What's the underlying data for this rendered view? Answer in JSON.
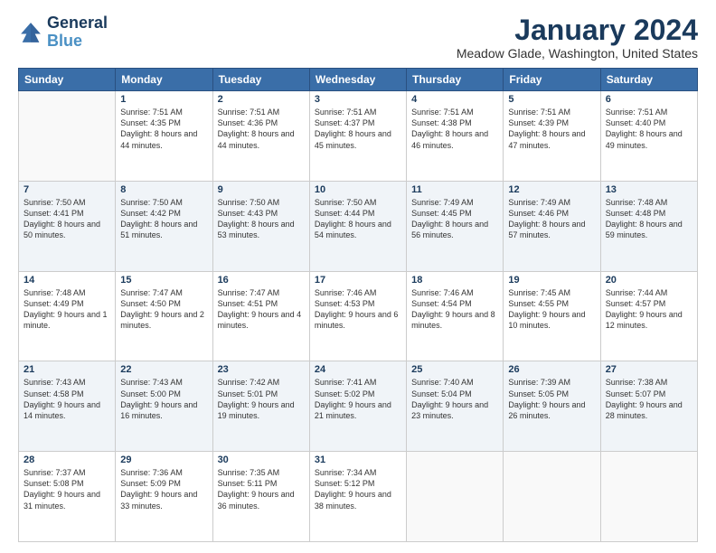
{
  "logo": {
    "text_general": "General",
    "text_blue": "Blue"
  },
  "title": "January 2024",
  "location": "Meadow Glade, Washington, United States",
  "days_of_week": [
    "Sunday",
    "Monday",
    "Tuesday",
    "Wednesday",
    "Thursday",
    "Friday",
    "Saturday"
  ],
  "weeks": [
    [
      {
        "day": "",
        "sunrise": "",
        "sunset": "",
        "daylight": ""
      },
      {
        "day": "1",
        "sunrise": "Sunrise: 7:51 AM",
        "sunset": "Sunset: 4:35 PM",
        "daylight": "Daylight: 8 hours and 44 minutes."
      },
      {
        "day": "2",
        "sunrise": "Sunrise: 7:51 AM",
        "sunset": "Sunset: 4:36 PM",
        "daylight": "Daylight: 8 hours and 44 minutes."
      },
      {
        "day": "3",
        "sunrise": "Sunrise: 7:51 AM",
        "sunset": "Sunset: 4:37 PM",
        "daylight": "Daylight: 8 hours and 45 minutes."
      },
      {
        "day": "4",
        "sunrise": "Sunrise: 7:51 AM",
        "sunset": "Sunset: 4:38 PM",
        "daylight": "Daylight: 8 hours and 46 minutes."
      },
      {
        "day": "5",
        "sunrise": "Sunrise: 7:51 AM",
        "sunset": "Sunset: 4:39 PM",
        "daylight": "Daylight: 8 hours and 47 minutes."
      },
      {
        "day": "6",
        "sunrise": "Sunrise: 7:51 AM",
        "sunset": "Sunset: 4:40 PM",
        "daylight": "Daylight: 8 hours and 49 minutes."
      }
    ],
    [
      {
        "day": "7",
        "sunrise": "Sunrise: 7:50 AM",
        "sunset": "Sunset: 4:41 PM",
        "daylight": "Daylight: 8 hours and 50 minutes."
      },
      {
        "day": "8",
        "sunrise": "Sunrise: 7:50 AM",
        "sunset": "Sunset: 4:42 PM",
        "daylight": "Daylight: 8 hours and 51 minutes."
      },
      {
        "day": "9",
        "sunrise": "Sunrise: 7:50 AM",
        "sunset": "Sunset: 4:43 PM",
        "daylight": "Daylight: 8 hours and 53 minutes."
      },
      {
        "day": "10",
        "sunrise": "Sunrise: 7:50 AM",
        "sunset": "Sunset: 4:44 PM",
        "daylight": "Daylight: 8 hours and 54 minutes."
      },
      {
        "day": "11",
        "sunrise": "Sunrise: 7:49 AM",
        "sunset": "Sunset: 4:45 PM",
        "daylight": "Daylight: 8 hours and 56 minutes."
      },
      {
        "day": "12",
        "sunrise": "Sunrise: 7:49 AM",
        "sunset": "Sunset: 4:46 PM",
        "daylight": "Daylight: 8 hours and 57 minutes."
      },
      {
        "day": "13",
        "sunrise": "Sunrise: 7:48 AM",
        "sunset": "Sunset: 4:48 PM",
        "daylight": "Daylight: 8 hours and 59 minutes."
      }
    ],
    [
      {
        "day": "14",
        "sunrise": "Sunrise: 7:48 AM",
        "sunset": "Sunset: 4:49 PM",
        "daylight": "Daylight: 9 hours and 1 minute."
      },
      {
        "day": "15",
        "sunrise": "Sunrise: 7:47 AM",
        "sunset": "Sunset: 4:50 PM",
        "daylight": "Daylight: 9 hours and 2 minutes."
      },
      {
        "day": "16",
        "sunrise": "Sunrise: 7:47 AM",
        "sunset": "Sunset: 4:51 PM",
        "daylight": "Daylight: 9 hours and 4 minutes."
      },
      {
        "day": "17",
        "sunrise": "Sunrise: 7:46 AM",
        "sunset": "Sunset: 4:53 PM",
        "daylight": "Daylight: 9 hours and 6 minutes."
      },
      {
        "day": "18",
        "sunrise": "Sunrise: 7:46 AM",
        "sunset": "Sunset: 4:54 PM",
        "daylight": "Daylight: 9 hours and 8 minutes."
      },
      {
        "day": "19",
        "sunrise": "Sunrise: 7:45 AM",
        "sunset": "Sunset: 4:55 PM",
        "daylight": "Daylight: 9 hours and 10 minutes."
      },
      {
        "day": "20",
        "sunrise": "Sunrise: 7:44 AM",
        "sunset": "Sunset: 4:57 PM",
        "daylight": "Daylight: 9 hours and 12 minutes."
      }
    ],
    [
      {
        "day": "21",
        "sunrise": "Sunrise: 7:43 AM",
        "sunset": "Sunset: 4:58 PM",
        "daylight": "Daylight: 9 hours and 14 minutes."
      },
      {
        "day": "22",
        "sunrise": "Sunrise: 7:43 AM",
        "sunset": "Sunset: 5:00 PM",
        "daylight": "Daylight: 9 hours and 16 minutes."
      },
      {
        "day": "23",
        "sunrise": "Sunrise: 7:42 AM",
        "sunset": "Sunset: 5:01 PM",
        "daylight": "Daylight: 9 hours and 19 minutes."
      },
      {
        "day": "24",
        "sunrise": "Sunrise: 7:41 AM",
        "sunset": "Sunset: 5:02 PM",
        "daylight": "Daylight: 9 hours and 21 minutes."
      },
      {
        "day": "25",
        "sunrise": "Sunrise: 7:40 AM",
        "sunset": "Sunset: 5:04 PM",
        "daylight": "Daylight: 9 hours and 23 minutes."
      },
      {
        "day": "26",
        "sunrise": "Sunrise: 7:39 AM",
        "sunset": "Sunset: 5:05 PM",
        "daylight": "Daylight: 9 hours and 26 minutes."
      },
      {
        "day": "27",
        "sunrise": "Sunrise: 7:38 AM",
        "sunset": "Sunset: 5:07 PM",
        "daylight": "Daylight: 9 hours and 28 minutes."
      }
    ],
    [
      {
        "day": "28",
        "sunrise": "Sunrise: 7:37 AM",
        "sunset": "Sunset: 5:08 PM",
        "daylight": "Daylight: 9 hours and 31 minutes."
      },
      {
        "day": "29",
        "sunrise": "Sunrise: 7:36 AM",
        "sunset": "Sunset: 5:09 PM",
        "daylight": "Daylight: 9 hours and 33 minutes."
      },
      {
        "day": "30",
        "sunrise": "Sunrise: 7:35 AM",
        "sunset": "Sunset: 5:11 PM",
        "daylight": "Daylight: 9 hours and 36 minutes."
      },
      {
        "day": "31",
        "sunrise": "Sunrise: 7:34 AM",
        "sunset": "Sunset: 5:12 PM",
        "daylight": "Daylight: 9 hours and 38 minutes."
      },
      {
        "day": "",
        "sunrise": "",
        "sunset": "",
        "daylight": ""
      },
      {
        "day": "",
        "sunrise": "",
        "sunset": "",
        "daylight": ""
      },
      {
        "day": "",
        "sunrise": "",
        "sunset": "",
        "daylight": ""
      }
    ]
  ]
}
